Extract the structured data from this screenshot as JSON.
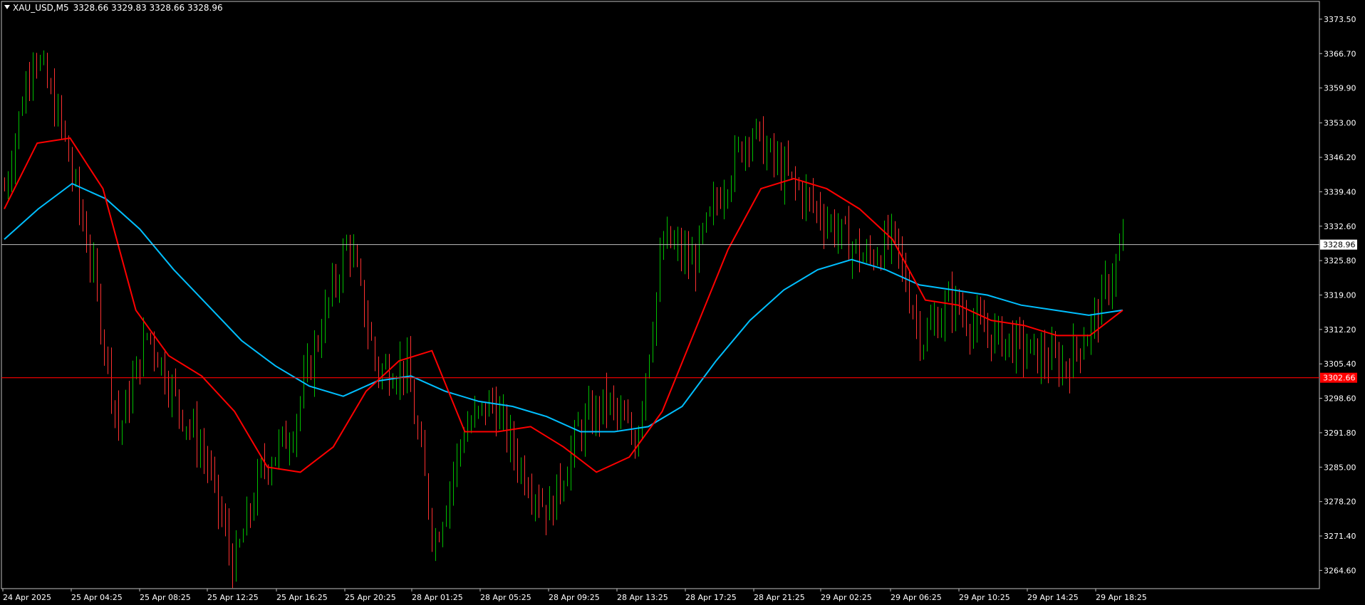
{
  "header": {
    "symbol": "XAU_USD,M5",
    "ohlc": "3328.66 3329.83 3328.66 3328.96"
  },
  "colors": {
    "background": "#000000",
    "frame": "#c0c0c0",
    "text": "#ffffff",
    "bull": "#00c000",
    "bear": "#ff3030",
    "ma_fast": "#ff0000",
    "ma_slow": "#00bfff",
    "bid_line": "#c0c0c0",
    "level_line": "#ff0000"
  },
  "price_labels": {
    "bid": "3328.96",
    "level": "3302.66"
  },
  "chart_data": {
    "type": "candlestick",
    "symbol": "XAU_USD",
    "timeframe": "M5",
    "ylim": [
      3261.0,
      3377.0
    ],
    "y_ticks": [
      "3373.50",
      "3366.70",
      "3359.90",
      "3353.00",
      "3346.20",
      "3339.40",
      "3332.60",
      "3325.80",
      "3319.00",
      "3312.20",
      "3305.40",
      "3298.60",
      "3291.80",
      "3285.00",
      "3278.20",
      "3271.40",
      "3264.60"
    ],
    "x_ticks": [
      "24 Apr 2025",
      "25 Apr 04:25",
      "25 Apr 08:25",
      "25 Apr 12:25",
      "25 Apr 16:25",
      "25 Apr 20:25",
      "28 Apr 01:25",
      "28 Apr 05:25",
      "28 Apr 09:25",
      "28 Apr 13:25",
      "28 Apr 17:25",
      "28 Apr 21:25",
      "29 Apr 02:25",
      "29 Apr 06:25",
      "29 Apr 10:25",
      "29 Apr 14:25",
      "29 Apr 18:25"
    ],
    "bid": 3328.96,
    "horizontal_level": 3302.66,
    "price_path": [
      {
        "t": "24 Apr 2025",
        "price": 3340
      },
      {
        "t": "24 Apr 2025 +1",
        "price": 3368
      },
      {
        "t": "25 Apr 04:25",
        "price": 3352
      },
      {
        "t": "25 Apr 06:25",
        "price": 3326
      },
      {
        "t": "25 Apr 08:25",
        "price": 3292
      },
      {
        "t": "25 Apr 09:25",
        "price": 3312
      },
      {
        "t": "25 Apr 12:25",
        "price": 3298
      },
      {
        "t": "25 Apr 14:25",
        "price": 3287
      },
      {
        "t": "25 Apr 16:25",
        "price": 3265
      },
      {
        "t": "25 Apr 18:25",
        "price": 3285
      },
      {
        "t": "25 Apr 20:25",
        "price": 3292
      },
      {
        "t": "25 Apr 22:25",
        "price": 3312
      },
      {
        "t": "28 Apr 00:25",
        "price": 3330
      },
      {
        "t": "28 Apr 01:25",
        "price": 3304
      },
      {
        "t": "28 Apr 03:25",
        "price": 3305
      },
      {
        "t": "28 Apr 04:25",
        "price": 3270
      },
      {
        "t": "28 Apr 05:25",
        "price": 3292
      },
      {
        "t": "28 Apr 07:25",
        "price": 3298
      },
      {
        "t": "28 Apr 09:25",
        "price": 3285
      },
      {
        "t": "28 Apr 11:25",
        "price": 3276
      },
      {
        "t": "28 Apr 13:25",
        "price": 3292
      },
      {
        "t": "28 Apr 15:25",
        "price": 3298
      },
      {
        "t": "28 Apr 17:25",
        "price": 3290
      },
      {
        "t": "28 Apr 18:25",
        "price": 3330
      },
      {
        "t": "28 Apr 19:25",
        "price": 3325
      },
      {
        "t": "28 Apr 20:25",
        "price": 3340
      },
      {
        "t": "28 Apr 21:25",
        "price": 3352
      },
      {
        "t": "28 Apr 23:25",
        "price": 3344
      },
      {
        "t": "29 Apr 00:25",
        "price": 3338
      },
      {
        "t": "29 Apr 02:25",
        "price": 3332
      },
      {
        "t": "29 Apr 03:25",
        "price": 3326
      },
      {
        "t": "29 Apr 04:25",
        "price": 3330
      },
      {
        "t": "29 Apr 06:25",
        "price": 3310
      },
      {
        "t": "29 Apr 08:25",
        "price": 3318
      },
      {
        "t": "29 Apr 10:25",
        "price": 3312
      },
      {
        "t": "29 Apr 12:25",
        "price": 3310
      },
      {
        "t": "29 Apr 14:25",
        "price": 3307
      },
      {
        "t": "29 Apr 15:25",
        "price": 3305
      },
      {
        "t": "29 Apr 17:25",
        "price": 3314
      },
      {
        "t": "29 Apr 18:25",
        "price": 3329
      }
    ],
    "ma_fast": [
      {
        "t": "24 Apr 2025",
        "value": 3336
      },
      {
        "t": "24 Apr 2025 +1",
        "value": 3349
      },
      {
        "t": "25 Apr 04:25",
        "value": 3350
      },
      {
        "t": "25 Apr 06:25",
        "value": 3340
      },
      {
        "t": "25 Apr 08:25",
        "value": 3316
      },
      {
        "t": "25 Apr 10:25",
        "value": 3307
      },
      {
        "t": "25 Apr 12:25",
        "value": 3303
      },
      {
        "t": "25 Apr 14:25",
        "value": 3296
      },
      {
        "t": "25 Apr 16:25",
        "value": 3285
      },
      {
        "t": "25 Apr 18:25",
        "value": 3284
      },
      {
        "t": "25 Apr 20:25",
        "value": 3289
      },
      {
        "t": "25 Apr 22:25",
        "value": 3300
      },
      {
        "t": "28 Apr 00:25",
        "value": 3306
      },
      {
        "t": "28 Apr 01:25",
        "value": 3308
      },
      {
        "t": "28 Apr 03:25",
        "value": 3292
      },
      {
        "t": "28 Apr 05:25",
        "value": 3292
      },
      {
        "t": "28 Apr 07:25",
        "value": 3293
      },
      {
        "t": "28 Apr 09:25",
        "value": 3289
      },
      {
        "t": "28 Apr 11:25",
        "value": 3284
      },
      {
        "t": "28 Apr 13:25",
        "value": 3287
      },
      {
        "t": "28 Apr 15:25",
        "value": 3296
      },
      {
        "t": "28 Apr 17:25",
        "value": 3312
      },
      {
        "t": "28 Apr 19:25",
        "value": 3328
      },
      {
        "t": "28 Apr 21:25",
        "value": 3340
      },
      {
        "t": "28 Apr 22:25",
        "value": 3342
      },
      {
        "t": "29 Apr 00:25",
        "value": 3340
      },
      {
        "t": "29 Apr 02:25",
        "value": 3336
      },
      {
        "t": "29 Apr 04:25",
        "value": 3330
      },
      {
        "t": "29 Apr 06:25",
        "value": 3318
      },
      {
        "t": "29 Apr 08:25",
        "value": 3317
      },
      {
        "t": "29 Apr 10:25",
        "value": 3314
      },
      {
        "t": "29 Apr 12:25",
        "value": 3313
      },
      {
        "t": "29 Apr 14:25",
        "value": 3311
      },
      {
        "t": "29 Apr 16:25",
        "value": 3311
      },
      {
        "t": "29 Apr 18:25",
        "value": 3316
      }
    ],
    "ma_slow": [
      {
        "t": "24 Apr 2025",
        "value": 3330
      },
      {
        "t": "24 Apr 2025 +1",
        "value": 3336
      },
      {
        "t": "25 Apr 04:25",
        "value": 3341
      },
      {
        "t": "25 Apr 06:25",
        "value": 3338
      },
      {
        "t": "25 Apr 08:25",
        "value": 3332
      },
      {
        "t": "25 Apr 10:25",
        "value": 3324
      },
      {
        "t": "25 Apr 12:25",
        "value": 3317
      },
      {
        "t": "25 Apr 14:25",
        "value": 3310
      },
      {
        "t": "25 Apr 16:25",
        "value": 3305
      },
      {
        "t": "25 Apr 18:25",
        "value": 3301
      },
      {
        "t": "25 Apr 20:25",
        "value": 3299
      },
      {
        "t": "25 Apr 22:25",
        "value": 3302
      },
      {
        "t": "28 Apr 01:25",
        "value": 3303
      },
      {
        "t": "28 Apr 03:25",
        "value": 3300
      },
      {
        "t": "28 Apr 05:25",
        "value": 3298
      },
      {
        "t": "28 Apr 07:25",
        "value": 3297
      },
      {
        "t": "28 Apr 09:25",
        "value": 3295
      },
      {
        "t": "28 Apr 11:25",
        "value": 3292
      },
      {
        "t": "28 Apr 13:25",
        "value": 3292
      },
      {
        "t": "28 Apr 15:25",
        "value": 3293
      },
      {
        "t": "28 Apr 17:25",
        "value": 3297
      },
      {
        "t": "28 Apr 19:25",
        "value": 3306
      },
      {
        "t": "28 Apr 21:25",
        "value": 3314
      },
      {
        "t": "28 Apr 23:25",
        "value": 3320
      },
      {
        "t": "29 Apr 01:25",
        "value": 3324
      },
      {
        "t": "29 Apr 03:25",
        "value": 3326
      },
      {
        "t": "29 Apr 05:25",
        "value": 3324
      },
      {
        "t": "29 Apr 07:25",
        "value": 3321
      },
      {
        "t": "29 Apr 09:25",
        "value": 3320
      },
      {
        "t": "29 Apr 11:25",
        "value": 3319
      },
      {
        "t": "29 Apr 13:25",
        "value": 3317
      },
      {
        "t": "29 Apr 15:25",
        "value": 3316
      },
      {
        "t": "29 Apr 17:25",
        "value": 3315
      },
      {
        "t": "29 Apr 18:25",
        "value": 3316
      }
    ]
  }
}
